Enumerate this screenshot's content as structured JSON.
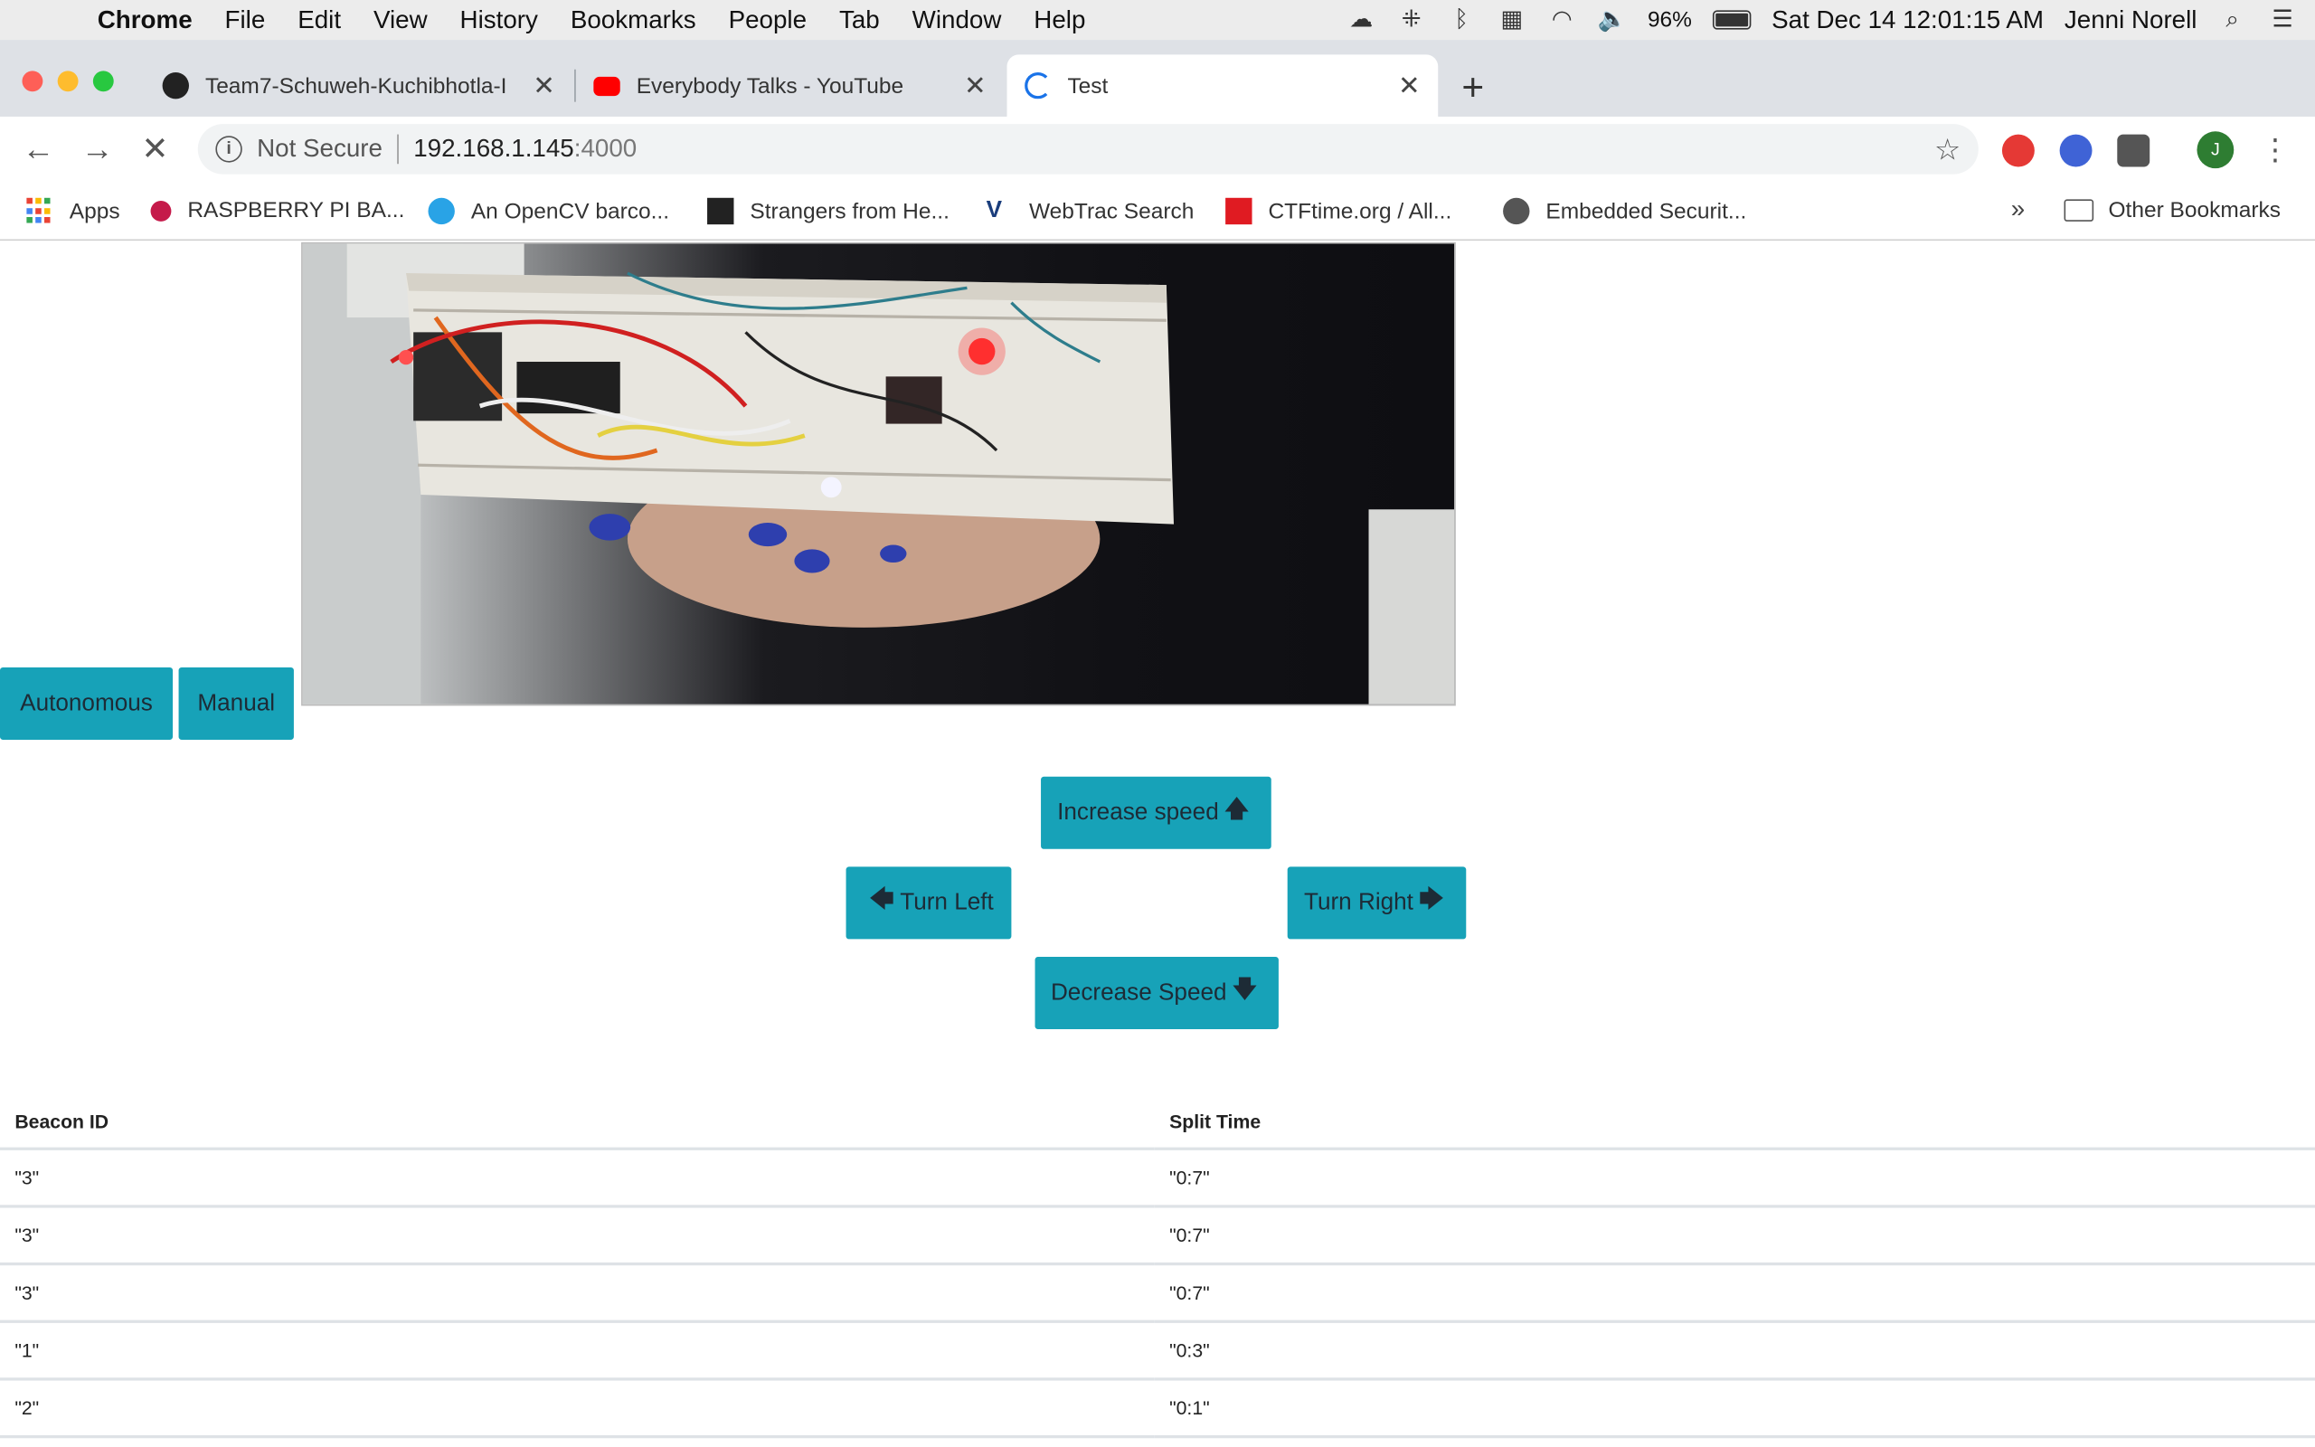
{
  "menubar": {
    "app": "Chrome",
    "items": [
      "File",
      "Edit",
      "View",
      "History",
      "Bookmarks",
      "People",
      "Tab",
      "Window",
      "Help"
    ],
    "battery_pct": "96%",
    "datetime": "Sat Dec 14  12:01:15 AM",
    "user": "Jenni Norell"
  },
  "tabs": [
    {
      "title": "Team7-Schuweh-Kuchibhotla-I",
      "active": false
    },
    {
      "title": "Everybody Talks - YouTube",
      "active": false
    },
    {
      "title": "Test",
      "active": true
    }
  ],
  "toolbar": {
    "security": "Not Secure",
    "url_host": "192.168.1.145",
    "url_port": ":4000"
  },
  "bookmarks": [
    {
      "label": "Apps"
    },
    {
      "label": "RASPBERRY PI BA..."
    },
    {
      "label": "An OpenCV barco..."
    },
    {
      "label": "Strangers from He..."
    },
    {
      "label": "WebTrac Search"
    },
    {
      "label": "CTFtime.org / All..."
    },
    {
      "label": "Embedded Securit..."
    }
  ],
  "bookmarks_more": "»",
  "other_bookmarks": "Other Bookmarks",
  "controls": {
    "autonomous": "Autonomous",
    "manual": "Manual",
    "increase": "Increase speed",
    "decrease": "Decrease Speed",
    "left": "Turn Left",
    "right": "Turn Right"
  },
  "table": {
    "headers": [
      "Beacon ID",
      "Split Time"
    ],
    "rows": [
      [
        "\"3\"",
        "\"0:7\""
      ],
      [
        "\"3\"",
        "\"0:7\""
      ],
      [
        "\"3\"",
        "\"0:7\""
      ],
      [
        "\"1\"",
        "\"0:3\""
      ],
      [
        "\"2\"",
        "\"0:1\""
      ]
    ]
  },
  "colors": {
    "button_bg": "#17a2b8",
    "accent_blue": "#1a73e8"
  }
}
